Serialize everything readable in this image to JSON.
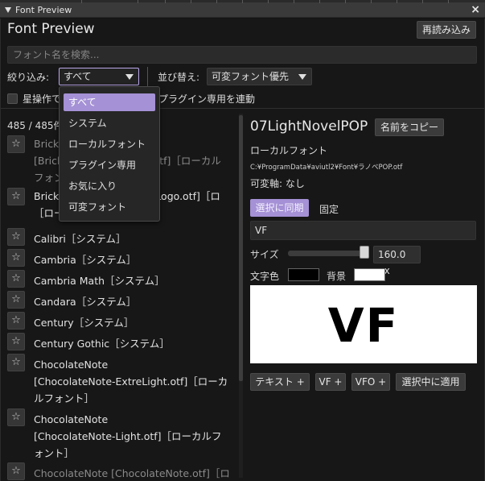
{
  "window": {
    "title": "Font Preview",
    "close_glyph": "×"
  },
  "header": {
    "title": "Font Preview",
    "reload_label": "再読み込み"
  },
  "search": {
    "placeholder": "フォント名を検索..."
  },
  "filter": {
    "label": "絞り込み:",
    "selected": "すべて",
    "options": [
      "すべて",
      "システム",
      "ローカルフォント",
      "プラグイン専用",
      "お気に入り",
      "可変フォント"
    ]
  },
  "sort": {
    "label": "並び替え:",
    "selected": "可変フォント優先"
  },
  "options_row": {
    "star_label_visible": "星操作で",
    "plugin_sync_label": "プラグイン専用を連動"
  },
  "count_text": "485 / 485件",
  "star_glyph": "☆",
  "font_list": [
    {
      "lines": [
        "Brick",
        "[Brick",
        "フォン"
      ],
      "tail": [
        "tf]［ローカル"
      ]
    },
    {
      "lines": [
        "Brick",
        "［ローカ"
      ],
      "tail": [
        "Logo.otf]［ロ"
      ]
    },
    {
      "name": "Calibri［システム］"
    },
    {
      "name": "Cambria［システム］"
    },
    {
      "name": "Cambria Math［システム］"
    },
    {
      "name": "Candara［システム］"
    },
    {
      "name": "Century［システム］"
    },
    {
      "name": "Century Gothic［システム］"
    },
    {
      "name": "ChocolateNote\n[ChocolateNote-ExtreLight.otf]［ローカ\nルフォント］"
    },
    {
      "name": "ChocolateNote\n[ChocolateNote-Light.otf]［ローカルフ\nォント］"
    },
    {
      "name": "ChocolateNote [ChocolateNote.otf]［ロ"
    }
  ],
  "detail": {
    "font_name": "07LightNovelPOP",
    "copy_name_label": "名前をコピー",
    "source": "ローカルフォント",
    "path": "C:¥ProgramData¥aviutl2¥Font¥ラノベPOP.otf",
    "variable_axes": "可変軸: なし",
    "sync_label": "選択に同期",
    "fixed_label": "固定",
    "sample_text": "VF",
    "size_label": "サイズ",
    "size_value": "160.0 px",
    "size_fraction": 0.95,
    "text_color_label": "文字色",
    "background_label": "背景",
    "text_color": "#000000",
    "background_color": "#ffffff",
    "preview_text": "VF",
    "actions": [
      "テキスト +",
      "VF +",
      "VFO +",
      "選択中に適用"
    ]
  },
  "colors": {
    "accent": "#a591d5"
  }
}
